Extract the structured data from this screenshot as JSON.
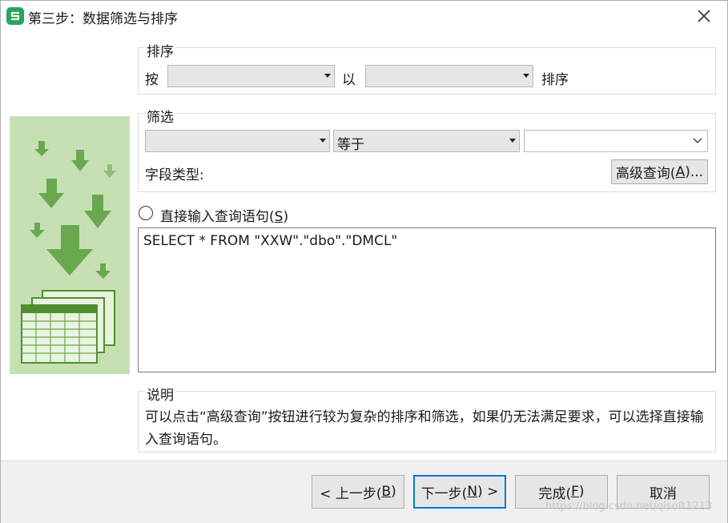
{
  "window": {
    "title": "第三步：数据筛选与排序",
    "app_icon_glyph": "S",
    "accent": "#2aa55c"
  },
  "sort": {
    "group_label": "排序",
    "by_label": "按",
    "field1_value": "",
    "with_label": "以",
    "field2_value": "",
    "suffix_label": "排序"
  },
  "filter": {
    "group_label": "筛选",
    "field_value": "",
    "operator_value": "等于",
    "value_value": "",
    "field_type_label": "字段类型:",
    "advanced_button": {
      "text": "高级查询(",
      "mnemonic": "A",
      "after": ")..."
    }
  },
  "direct": {
    "label": "直接输入查询语句(",
    "mnemonic": "S",
    "after": ")",
    "sql": "SELECT * FROM \"XXW\".\"dbo\".\"DMCL\""
  },
  "description": {
    "group_label": "说明",
    "text": "可以点击“高级查询”按钮进行较为复杂的排序和筛选，如果仍无法满足要求，可以选择直接输入查询语句。"
  },
  "footer": {
    "prev": {
      "text": "< 上一步(",
      "mnemonic": "B",
      "after": ")"
    },
    "next": {
      "text": "下一步(",
      "mnemonic": "N",
      "after": ") >"
    },
    "finish": {
      "text": "完成(",
      "mnemonic": "F",
      "after": ")"
    },
    "cancel": {
      "text": "取消"
    }
  },
  "watermark": "https://blog.csdn.net/qisoft1213",
  "colors": {
    "illustration_bg": "#c6e0b4",
    "arrow_green": "#6aa84f",
    "focus_border": "#0078d7"
  }
}
